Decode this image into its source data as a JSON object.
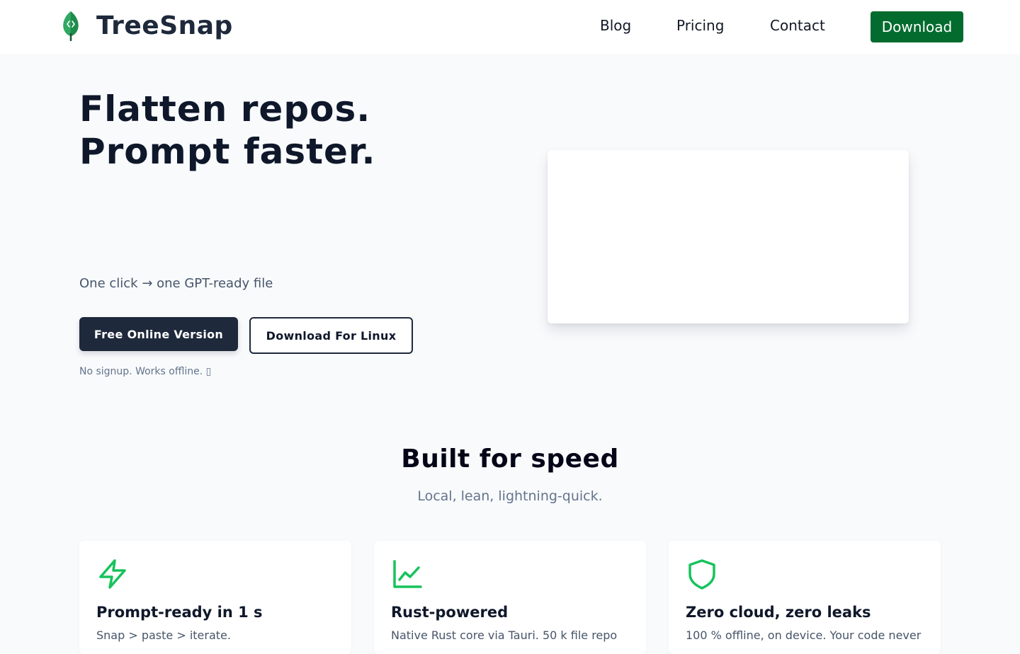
{
  "header": {
    "brand": "TreeSnap",
    "nav": [
      "Blog",
      "Pricing",
      "Contact"
    ],
    "download_label": "Download"
  },
  "hero": {
    "title": "Flatten repos. Prompt faster.",
    "subtitle": "One click → one GPT-ready file",
    "primary_button": "Free Online Version",
    "secondary_button": "Download For Linux",
    "note": "No signup. Works offline. ▯"
  },
  "features": {
    "title": "Built for speed",
    "subtitle": "Local, lean, lightning-quick.",
    "items": [
      {
        "icon": "lightning-icon",
        "title": "Prompt-ready in 1 s",
        "text": "Snap > paste > iterate."
      },
      {
        "icon": "line-chart-icon",
        "title": "Rust-powered",
        "text": "Native Rust core via Tauri. 50 k file repo"
      },
      {
        "icon": "shield-icon",
        "title": "Zero cloud, zero leaks",
        "text": "100 % offline, on device. Your code never"
      }
    ]
  },
  "colors": {
    "brand_green": "#036b2e",
    "accent_green": "#16c35b",
    "dark": "#1e293b",
    "background": "#f8fafc"
  }
}
